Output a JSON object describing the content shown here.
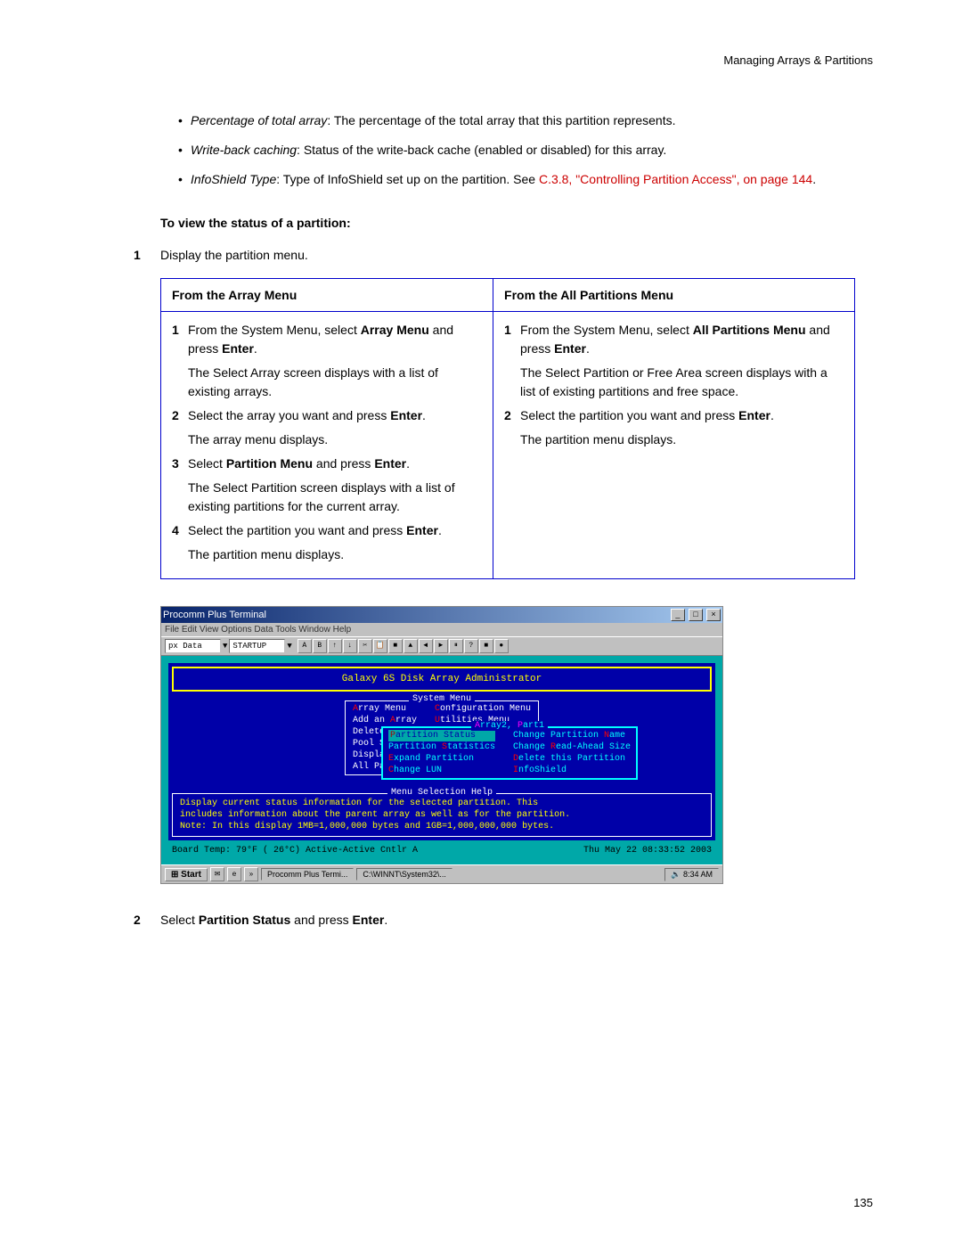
{
  "header": "Managing Arrays & Partitions",
  "bullets": {
    "b1_term": "Percentage of total array",
    "b1_rest": ": The percentage of the total array that this partition represents.",
    "b2_term": "Write-back caching",
    "b2_rest": ": Status of the write-back cache (enabled or disabled) for this array.",
    "b3_term": "InfoShield Type",
    "b3_rest": ": Type of InfoShield set up on the partition. See ",
    "b3_link": "C.3.8, \"Controlling Partition Access\", on page 144",
    "b3_end": "."
  },
  "section_heading": "To view the status of a partition:",
  "step1_num": "1",
  "step1_text": "Display the partition menu.",
  "table": {
    "h1": "From the Array Menu",
    "h2": "From the All Partitions Menu",
    "left": {
      "n1": "1",
      "t1a": "From the System Menu, select ",
      "t1b": "Array Menu",
      "t1c": " and press ",
      "t1d": "Enter",
      "t1e": ".",
      "t1sub": "The Select Array screen displays with a list of existing arrays.",
      "n2": "2",
      "t2a": "Select the array you want and press ",
      "t2b": "Enter",
      "t2c": ".",
      "t2sub": "The array menu displays.",
      "n3": "3",
      "t3a": "Select ",
      "t3b": "Partition Menu",
      "t3c": " and press ",
      "t3d": "Enter",
      "t3e": ".",
      "t3sub": "The Select Partition screen displays with a list of existing partitions for the current array.",
      "n4": "4",
      "t4a": "Select the partition you want and press ",
      "t4b": "Enter",
      "t4c": ".",
      "t4sub": "The partition menu displays."
    },
    "right": {
      "n1": "1",
      "t1a": "From the System Menu, select ",
      "t1b": "All Partitions Menu",
      "t1c": " and press ",
      "t1d": "Enter",
      "t1e": ".",
      "t1sub": "The Select Partition or Free Area screen displays with a list of existing partitions and free space.",
      "n2": "2",
      "t2a": "Select the partition you want and press ",
      "t2b": "Enter",
      "t2c": ".",
      "t2sub": "The partition menu displays."
    }
  },
  "screenshot": {
    "window_title": "Procomm Plus Terminal",
    "menubar": "File  Edit  View  Options  Data  Tools  Window  Help",
    "tb_field1": "px Data",
    "tb_field2": "STARTUP",
    "term_title": "Galaxy 6S Disk Array Administrator",
    "sys_menu_label": "System Menu",
    "left_menu": {
      "l1": "Array Menu",
      "l2": "Add an Array",
      "l3": "Delete",
      "l4": "Pool Sp",
      "l5": "Display",
      "l6": "All Par"
    },
    "right_menu": {
      "r1": "Configuration Menu",
      "r2": "Utilities Menu"
    },
    "overlay_label": "Array2, Part1",
    "overlay_left": {
      "o1": "Partition Status",
      "o2": "Partition Statistics",
      "o3": "Expand Partition",
      "o4": "Change LUN"
    },
    "overlay_right": {
      "o1": "Change Partition Name",
      "o2": "Change Read-Ahead Size",
      "o3": "Delete this Partition",
      "o4": "InfoShield"
    },
    "help_label": "Menu Selection Help",
    "help_l1": "Display current status information for the selected partition.  This",
    "help_l2": "includes information about the parent array as well as for the partition.",
    "help_l3": "Note: In this display 1MB=1,000,000 bytes and 1GB=1,000,000,000 bytes.",
    "status_left": "Board Temp:  79°F ( 26°C)  Active-Active   Cntlr A",
    "status_right": "Thu May 22 08:33:52 2003",
    "taskbar": {
      "start": "Start",
      "task1": "Procomm Plus Termi...",
      "task2": "C:\\WINNT\\System32\\...",
      "clock": "8:34 AM"
    }
  },
  "step2_num": "2",
  "step2_a": "Select ",
  "step2_b": "Partition Status",
  "step2_c": " and press ",
  "step2_d": "Enter",
  "step2_e": ".",
  "page_number": "135"
}
